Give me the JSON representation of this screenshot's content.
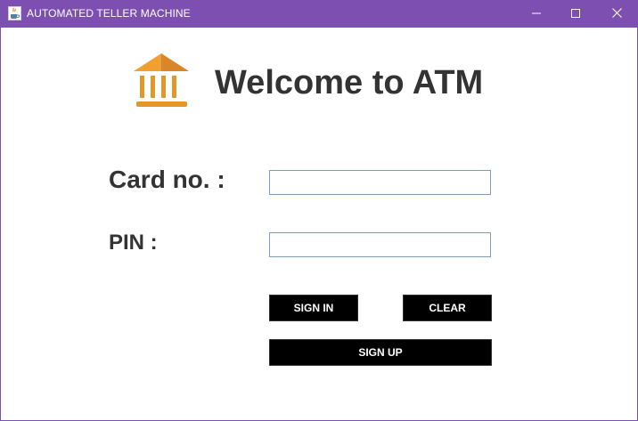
{
  "window": {
    "title": "AUTOMATED TELLER MACHINE",
    "app_icon": "java-cup-icon",
    "controls": {
      "minimize_icon": "minimize-icon",
      "maximize_icon": "maximize-icon",
      "close_icon": "close-icon"
    },
    "accent_color": "#7c4fb0"
  },
  "header": {
    "logo_icon": "bank-icon",
    "logo_color": "#e59628",
    "title": "Welcome to ATM"
  },
  "form": {
    "card_label": "Card no. :",
    "card_value": "",
    "pin_label": "PIN :",
    "pin_value": ""
  },
  "buttons": {
    "sign_in": "SIGN IN",
    "clear": "CLEAR",
    "sign_up": "SIGN UP"
  }
}
